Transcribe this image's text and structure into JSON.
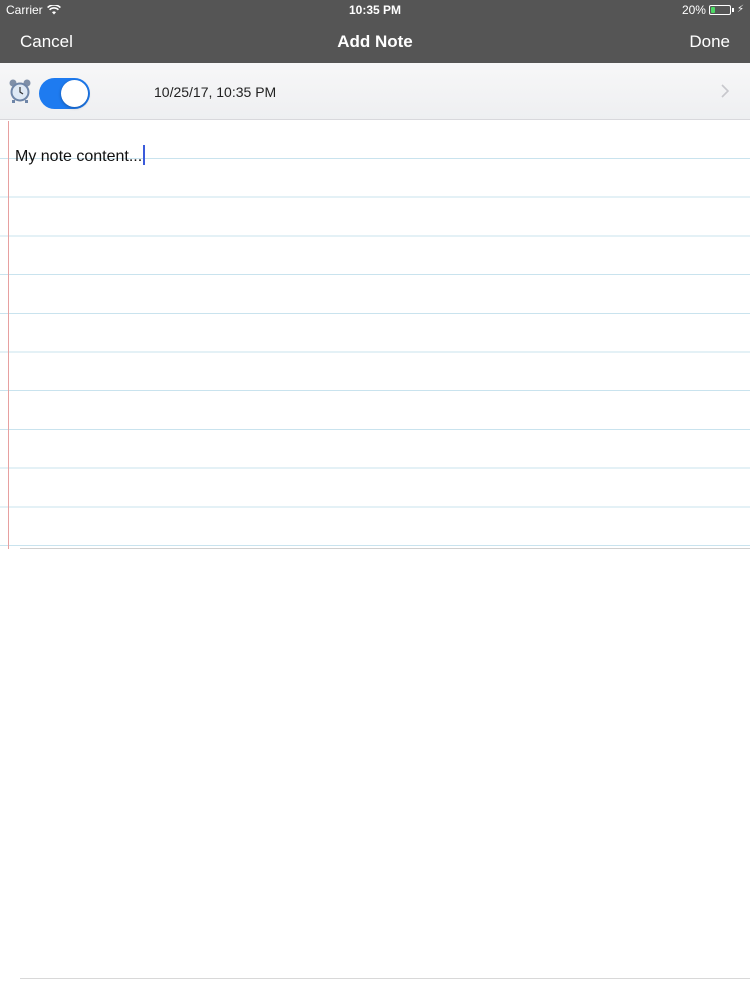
{
  "status_bar": {
    "carrier": "Carrier",
    "time": "10:35 PM",
    "battery": "20%",
    "battery_level": 0.2,
    "wifi_icon": "wifi-icon",
    "charging_icon": "bolt-icon"
  },
  "nav": {
    "cancel_label": "Cancel",
    "title": "Add Note",
    "done_label": "Done"
  },
  "reminder": {
    "enabled": true,
    "datetime": "10/25/17, 10:35 PM",
    "icon": "alarm-clock-icon",
    "chevron_icon": "chevron-right-icon"
  },
  "note": {
    "content": "My note content..."
  },
  "colors": {
    "nav_background": "#555555",
    "toggle_on": "#1e7bf0",
    "paper_line": "#c9e3ee",
    "paper_margin": "#e7a0a0",
    "battery_fill": "#4cd964"
  }
}
